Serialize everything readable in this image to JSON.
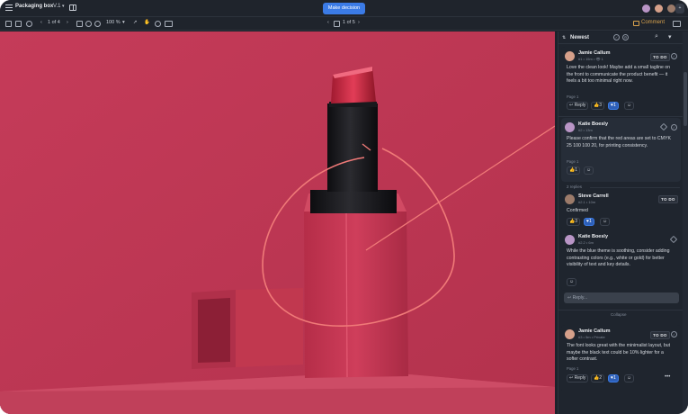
{
  "app": {
    "file_title": "Packaging box",
    "version": "V.1",
    "make_decision_label": "Make decision",
    "extra_collaborators": "+"
  },
  "toolbar": {
    "page_indicator": "1 of 4",
    "zoom": "100 %",
    "frame_indicator": "1 of 5",
    "comment_label": "Comment"
  },
  "panel": {
    "sort_label": "Newest"
  },
  "comments": [
    {
      "author": "Jamie Callum",
      "meta": "#1 • 15m • 👁 1",
      "status": "TO DO",
      "body": "Love the clean look! Maybe add a small tagline on the front to communicate the product benefit — it feels a bit too minimal right now.",
      "page": "Page 1",
      "reply_label": "Reply",
      "reaction_count": "3",
      "like_count": "1"
    },
    {
      "author": "Katie Boesly",
      "meta": "#2 • 13m",
      "body": "Please confirm that the red areas are set to CMYK 25 100 100 20, for printing consistency.",
      "page": "Page 1",
      "reaction_count": "1",
      "replies_label": "2 replies"
    },
    {
      "author": "Steve Carrell",
      "meta": "#2.1 • 10m",
      "status": "TO DO",
      "body": "Confirmed",
      "reaction_count": "3",
      "like_count": "1"
    },
    {
      "author": "Katie Boesly",
      "meta": "#2.2 • 6m",
      "body": "While the blue theme is soothing, consider adding contrasting colors (e.g., white or gold) for better visibility of text and key details."
    },
    {
      "reply_placeholder": "Reply...",
      "collapse_label": "Collapse"
    },
    {
      "author": "Jamie Callum",
      "meta": "#3 • 5m • Private",
      "status": "TO DO",
      "body": "The font looks great with the minimalist layout, but maybe the black text could be 10% lighter for a softer contrast.",
      "page": "Page 1",
      "reply_label": "Reply",
      "reaction_count": "2",
      "like_count": "1",
      "more": "•••"
    }
  ],
  "colors": {
    "accent": "#3b7be6",
    "canvas_red": "#c23a57",
    "annotation": "#f07a78",
    "todo_bg": "#2a303a"
  }
}
